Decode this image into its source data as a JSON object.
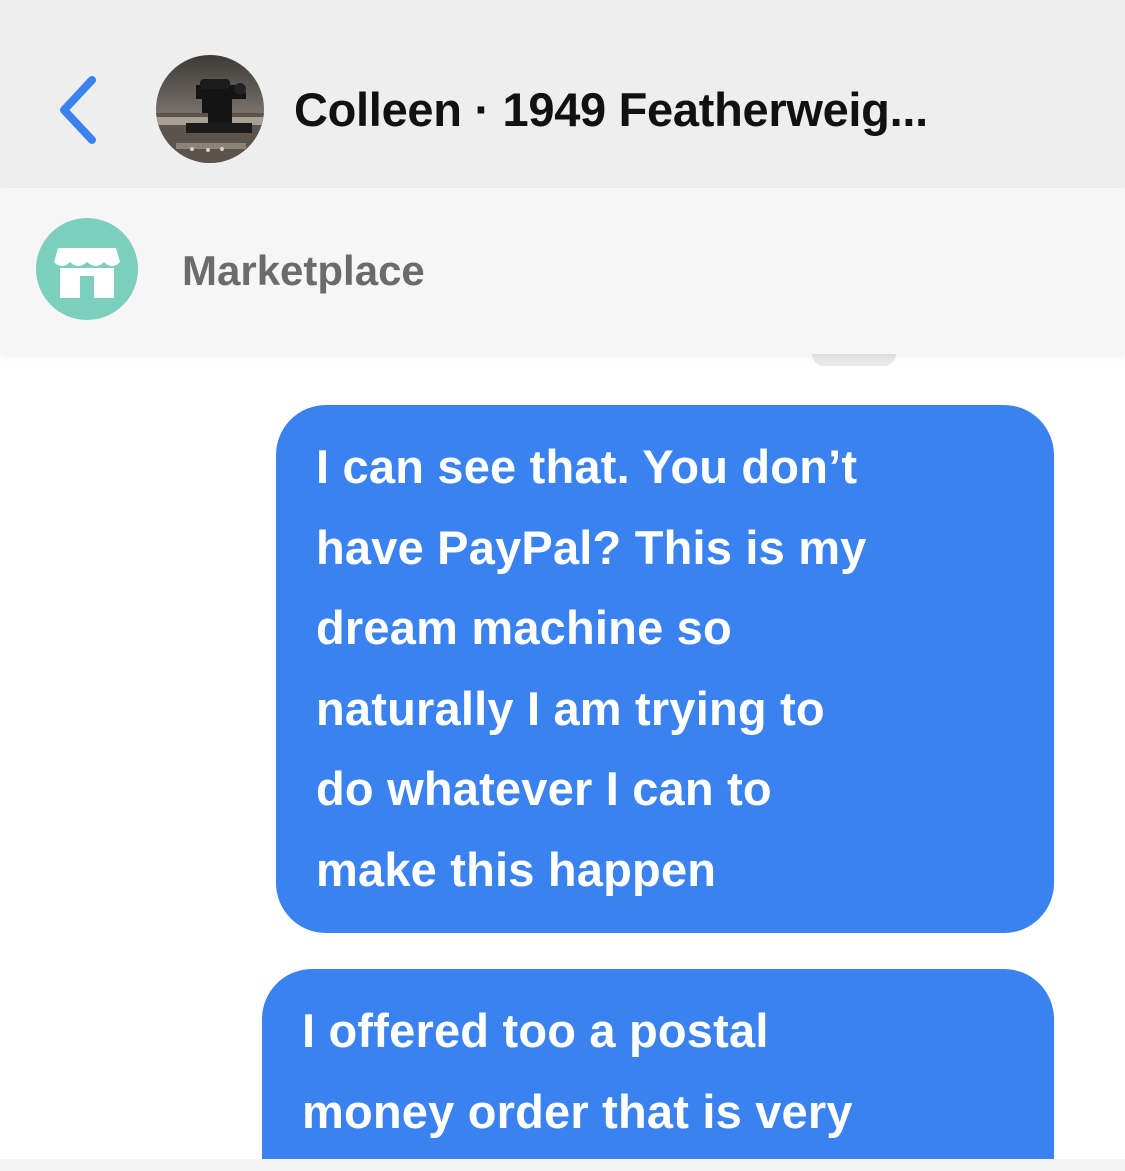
{
  "header": {
    "back_icon": "chevron-left-icon",
    "title": "Colleen · 1949 Featherweig...",
    "avatar": "sewing-machine-photo",
    "accent_color": "#3b82f1"
  },
  "marketplace": {
    "icon": "storefront-icon",
    "icon_color": "#7dcfbd",
    "label": "Marketplace"
  },
  "messages": [
    {
      "sender": "me",
      "lines": [
        "I can see that. You don’t",
        "have PayPal? This is my",
        "dream machine so",
        "naturally I am trying to",
        "do whatever I can to",
        "make this happen"
      ]
    },
    {
      "sender": "me",
      "lines": [
        "I offered too a postal",
        "money order that is very"
      ]
    }
  ]
}
